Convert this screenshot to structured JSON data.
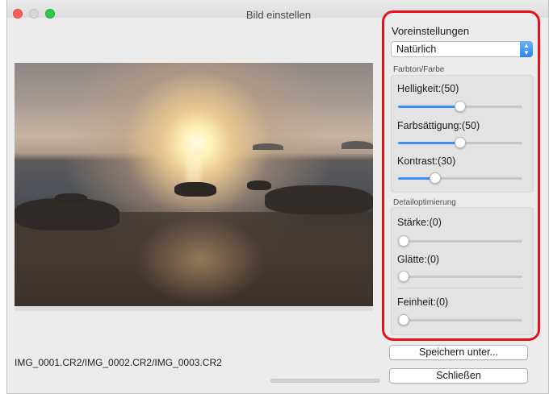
{
  "window": {
    "title": "Bild einstellen"
  },
  "panel": {
    "presets_label": "Voreinstellungen",
    "preset_selected": "Natürlich",
    "color_group": {
      "label": "Farbton/Farbe",
      "sliders": [
        {
          "label": "Helligkeit:(50)",
          "value": 50
        },
        {
          "label": "Farbsättigung:(50)",
          "value": 50
        },
        {
          "label": "Kontrast:(30)",
          "value": 30
        }
      ]
    },
    "detail_group": {
      "label": "Detailoptimierung",
      "sliders": [
        {
          "label": "Stärke:(0)",
          "value": 0
        },
        {
          "label": "Glätte:(0)",
          "value": 0
        },
        {
          "label": "Feinheit:(0)",
          "value": 0
        }
      ]
    }
  },
  "files": "IMG_0001.CR2/IMG_0002.CR2/IMG_0003.CR2",
  "buttons": {
    "save_as": "Speichern unter...",
    "close": "Schließen"
  },
  "colors": {
    "highlight_border": "#e8101a",
    "slider_fill": "#3b8ff5",
    "close": "#fc605b",
    "zoom": "#34c84a"
  },
  "icons": {
    "select_arrows": "up-down-chevron-icon"
  }
}
